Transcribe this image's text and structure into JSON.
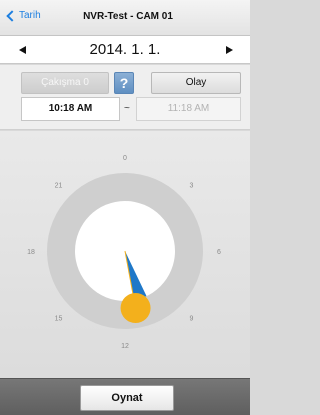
{
  "header": {
    "back_label": "Tarih",
    "title": "NVR-Test - CAM 01"
  },
  "date_bar": {
    "date": "2014. 1. 1."
  },
  "controls": {
    "overlap_label": "Çakışma 0",
    "help_label": "?",
    "event_label": "Olay",
    "start_time": "10:18 AM",
    "separator": "~",
    "end_time": "11:18 AM"
  },
  "clock": {
    "hour_labels": [
      "0",
      "3",
      "6",
      "9",
      "12",
      "15",
      "18",
      "21"
    ],
    "selection_start_hour": 10.3,
    "selection_end_hour": 11.3,
    "colors": {
      "outer_ring": "#cfcfcf",
      "inner_disc": "#ffffff",
      "selection_wedge": "#1f78c8",
      "handle": "#f3b01c"
    }
  },
  "footer": {
    "play_label": "Oynat"
  }
}
